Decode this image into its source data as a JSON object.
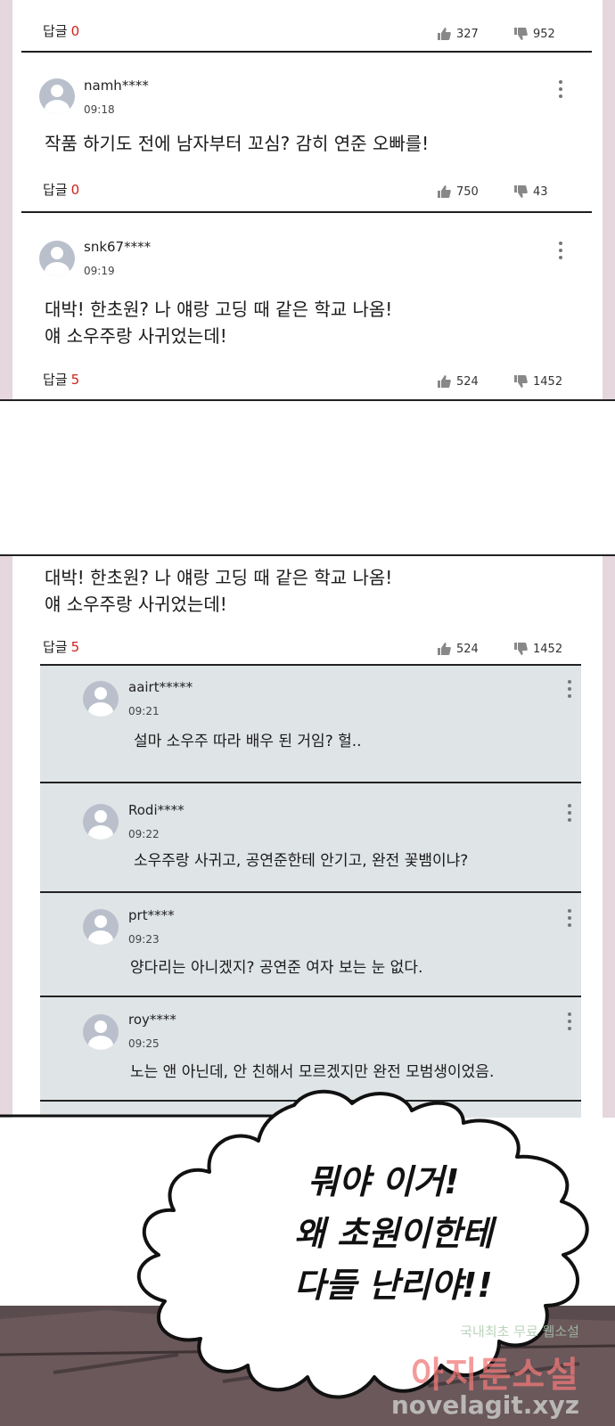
{
  "labels": {
    "reply": "답글"
  },
  "top_stub": {
    "replies": "0",
    "likes": "327",
    "dislikes": "952"
  },
  "comments": [
    {
      "user": "namh****",
      "time": "09:18",
      "text": "작품 하기도 전에 남자부터 꼬심? 감히 연준 오빠를!",
      "replies": "0",
      "likes": "750",
      "dislikes": "43"
    },
    {
      "user": "snk67****",
      "time": "09:19",
      "text1": "대박! 한초원? 나 얘랑 고딩 때 같은 학교 나옴!",
      "text2": "얘 소우주랑 사귀었는데!",
      "replies": "5",
      "likes": "524",
      "dislikes": "1452"
    }
  ],
  "panel2": {
    "parent": {
      "text1": "대박! 한초원? 나 얘랑 고딩 때 같은 학교 나옴!",
      "text2": "얘 소우주랑 사귀었는데!",
      "replies": "5",
      "likes": "524",
      "dislikes": "1452"
    },
    "replies": [
      {
        "user": "aairt*****",
        "time": "09:21",
        "text": "설마 소우주 따라 배우 된 거임? 헐.."
      },
      {
        "user": "Rodi****",
        "time": "09:22",
        "text": "소우주랑 사귀고, 공연준한테 안기고, 완전 꽃뱀이냐?"
      },
      {
        "user": "prt****",
        "time": "09:23",
        "text": "양다리는 아니겠지? 공연준 여자 보는 눈 없다."
      },
      {
        "user": "roy****",
        "time": "09:25",
        "text": "노는 앤 아닌데, 안 친해서 모르겠지만 완전 모범생이었음."
      }
    ]
  },
  "speech_bubble": {
    "line1": "뭐야 이거!",
    "line2": "왜 초원이한테",
    "line3": "다들 난리야!!"
  },
  "watermark": {
    "tagline": "국내최초 무료 웹소설",
    "brand": "아지툰소설",
    "url": "novelagit.xyz"
  }
}
